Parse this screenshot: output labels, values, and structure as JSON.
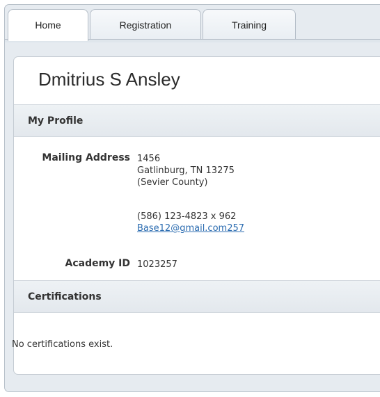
{
  "tabs": [
    {
      "label": "Home",
      "active": true
    },
    {
      "label": "Registration",
      "active": false
    },
    {
      "label": "Training",
      "active": false
    }
  ],
  "profile": {
    "name": "Dmitrius S Ansley",
    "section_title": "My Profile",
    "mailing_address_label": "Mailing Address",
    "address_line1": "1456",
    "address_line2": "Gatlinburg, TN 13275",
    "address_line3": "(Sevier County)",
    "phone": "(586) 123-4823 x 962",
    "email": "Base12@gmail.com257",
    "academy_id_label": "Academy ID",
    "academy_id": "1023257"
  },
  "certifications": {
    "section_title": "Certifications",
    "empty_message": "No certifications exist."
  },
  "colors": {
    "link": "#2a6bb0",
    "section_bg": "#e9edf1",
    "frame_bg": "#e6ebf0"
  }
}
